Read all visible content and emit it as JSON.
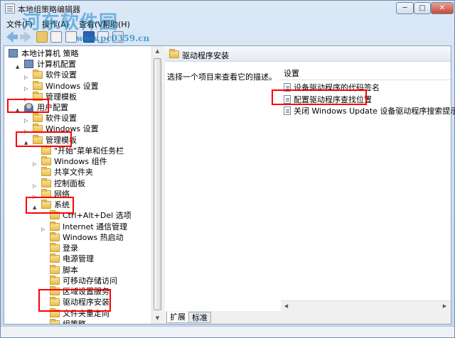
{
  "window": {
    "title": "本地组策略编辑器",
    "watermark": "河东软件园",
    "watermark_url": "www.pc0359.cn",
    "controls": {
      "minimize": "─",
      "maximize": "□",
      "close": "✕"
    }
  },
  "menubar": {
    "items": [
      {
        "label": "文件(F)"
      },
      {
        "label": "操作(A)"
      },
      {
        "label": "查看(V)"
      },
      {
        "label": "帮助(H)"
      }
    ]
  },
  "tree": {
    "items": [
      {
        "label": "本地计算机 策略",
        "twisty": "",
        "icon": "computer-icon"
      },
      {
        "label": "计算机配置",
        "twisty": "▲",
        "icon": "computer-icon"
      },
      {
        "label": "软件设置",
        "twisty": "▷",
        "icon": "folder-icon"
      },
      {
        "label": "Windows 设置",
        "twisty": "▷",
        "icon": "folder-icon"
      },
      {
        "label": "管理模板",
        "twisty": "▷",
        "icon": "folder-icon"
      },
      {
        "label": "用户配置",
        "twisty": "▲",
        "icon": "user-icon"
      },
      {
        "label": "软件设置",
        "twisty": "▷",
        "icon": "folder-icon"
      },
      {
        "label": "Windows 设置",
        "twisty": "▷",
        "icon": "folder-icon"
      },
      {
        "label": "管理模板",
        "twisty": "▲",
        "icon": "folder-icon"
      },
      {
        "label": "\"开始\"菜单和任务栏",
        "twisty": "",
        "icon": "folder-icon"
      },
      {
        "label": "Windows 组件",
        "twisty": "▷",
        "icon": "folder-icon"
      },
      {
        "label": "共享文件夹",
        "twisty": "",
        "icon": "folder-icon"
      },
      {
        "label": "控制面板",
        "twisty": "▷",
        "icon": "folder-icon"
      },
      {
        "label": "网络",
        "twisty": "▷",
        "icon": "folder-icon"
      },
      {
        "label": "系统",
        "twisty": "▲",
        "icon": "folder-icon"
      },
      {
        "label": "Ctrl+Alt+Del 选项",
        "twisty": "",
        "icon": "folder-icon"
      },
      {
        "label": "Internet 通信管理",
        "twisty": "▷",
        "icon": "folder-icon"
      },
      {
        "label": "Windows 热启动",
        "twisty": "",
        "icon": "folder-icon"
      },
      {
        "label": "登录",
        "twisty": "",
        "icon": "folder-icon"
      },
      {
        "label": "电源管理",
        "twisty": "",
        "icon": "folder-icon"
      },
      {
        "label": "脚本",
        "twisty": "",
        "icon": "folder-icon"
      },
      {
        "label": "可移动存储访问",
        "twisty": "",
        "icon": "folder-icon"
      },
      {
        "label": "区域设置服务",
        "twisty": "",
        "icon": "folder-icon"
      },
      {
        "label": "驱动程序安装",
        "twisty": "",
        "icon": "folder-icon"
      },
      {
        "label": "文件夹重定向",
        "twisty": "",
        "icon": "folder-icon"
      },
      {
        "label": "组策略",
        "twisty": "",
        "icon": "folder-icon"
      }
    ],
    "scroll_arrows": {
      "up": "▲",
      "down": "▼"
    }
  },
  "right_pane": {
    "header": "驱动程序安装",
    "description": "选择一个项目来查看它的描述。",
    "column_header": "设置",
    "policies": [
      {
        "label": "设备驱动程序的代码签名"
      },
      {
        "label": "配置驱动程序查找位置"
      },
      {
        "label": "关闭 Windows Update 设备驱动程序搜索提示"
      }
    ],
    "hscroll_arrows": {
      "left": "◀",
      "right": "▶"
    },
    "tabs": [
      {
        "label": "扩展"
      },
      {
        "label": "标准"
      }
    ]
  },
  "colors": {
    "highlight": "#ff0000",
    "window_frame": "#c6d9ee",
    "folder": "#e8bd4e"
  }
}
